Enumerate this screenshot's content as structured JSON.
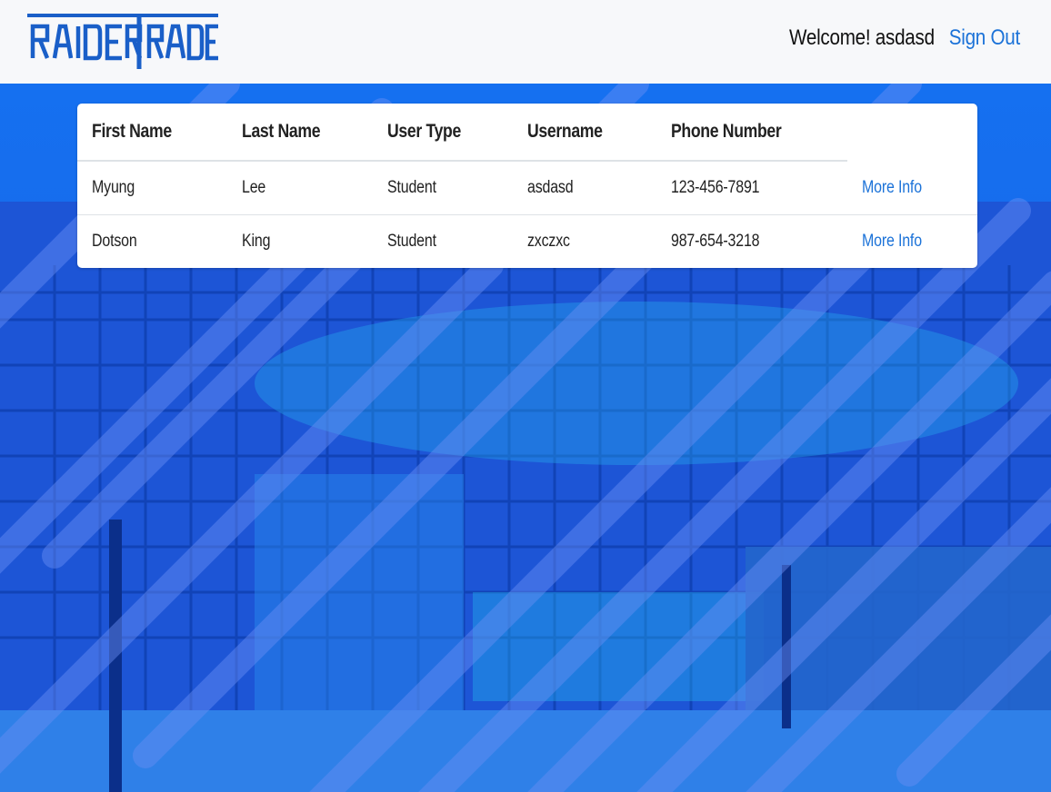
{
  "brand": {
    "logo_text": "RAIDERTRADE",
    "color": "#1a5fc8"
  },
  "header": {
    "welcome_text": "Welcome! asdasd",
    "signout_label": "Sign Out"
  },
  "users_table": {
    "columns": [
      "First Name",
      "Last Name",
      "User Type",
      "Username",
      "Phone Number",
      ""
    ],
    "rows": [
      {
        "first_name": "Myung",
        "last_name": "Lee",
        "user_type": "Student",
        "username": "asdasd",
        "phone": "123-456-7891",
        "action": "More Info"
      },
      {
        "first_name": "Dotson",
        "last_name": "King",
        "user_type": "Student",
        "username": "zxczxc",
        "phone": "987-654-3218",
        "action": "More Info"
      }
    ]
  },
  "colors": {
    "accent": "#1b72d8",
    "hero_overlay": "#1661e6",
    "header_bg": "#f7f8fa"
  }
}
